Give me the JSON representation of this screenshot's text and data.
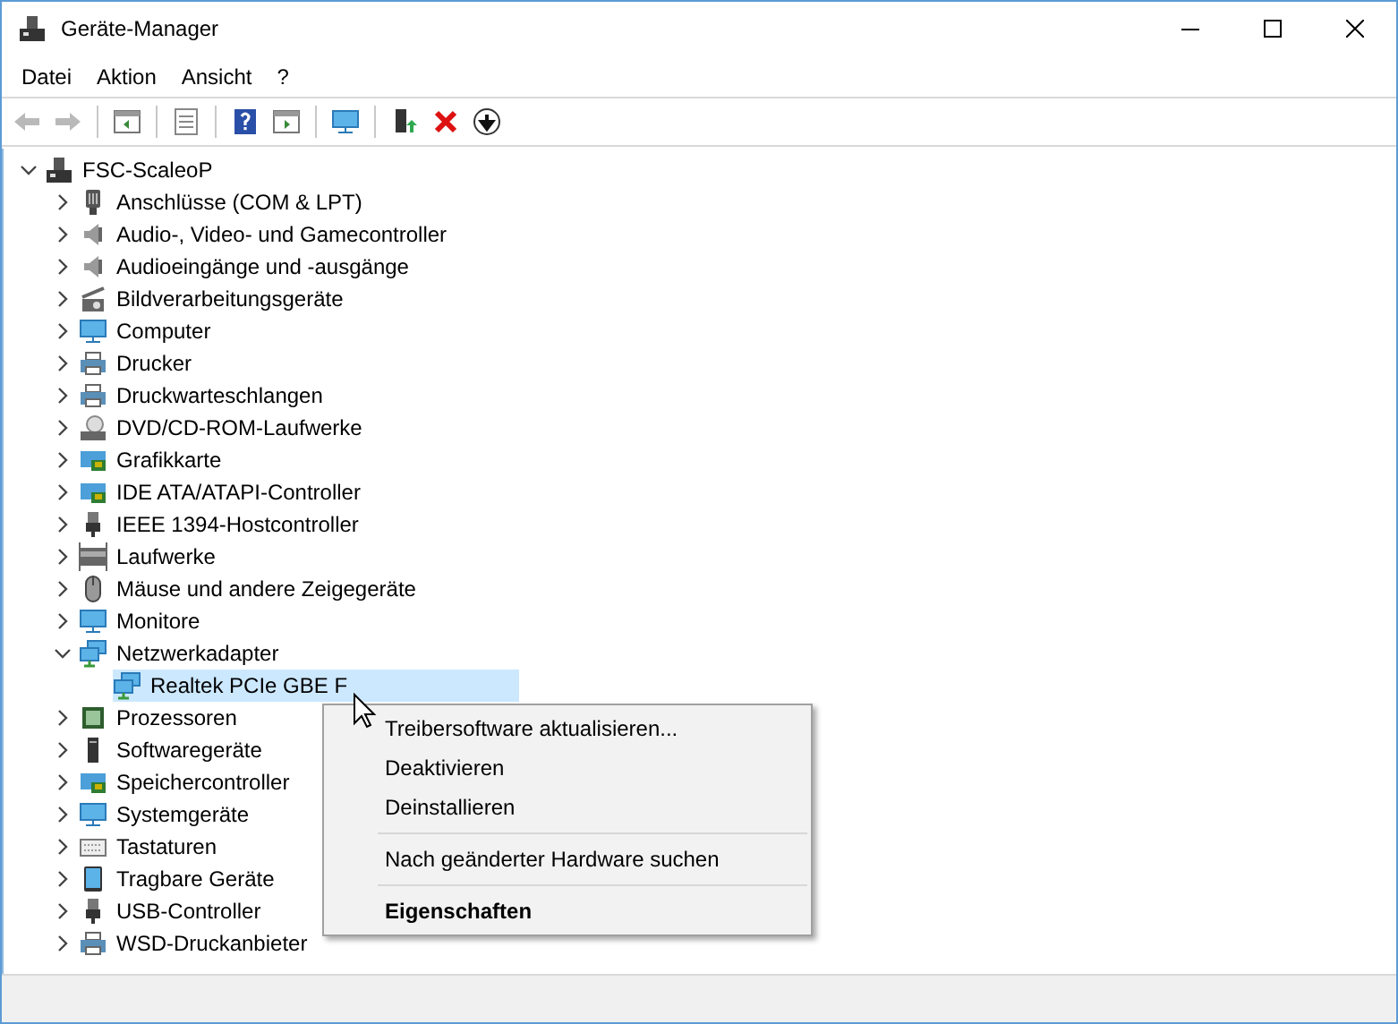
{
  "window": {
    "title": "Geräte-Manager"
  },
  "menu_bar": [
    "Datei",
    "Aktion",
    "Ansicht",
    "?"
  ],
  "toolbar": [
    {
      "kind": "back",
      "disabled": true
    },
    {
      "kind": "forward",
      "disabled": true
    },
    {
      "kind": "sep"
    },
    {
      "kind": "panel"
    },
    {
      "kind": "sep"
    },
    {
      "kind": "sheet"
    },
    {
      "kind": "sep"
    },
    {
      "kind": "help"
    },
    {
      "kind": "panel2"
    },
    {
      "kind": "sep"
    },
    {
      "kind": "monitor"
    },
    {
      "kind": "sep"
    },
    {
      "kind": "update"
    },
    {
      "kind": "remove"
    },
    {
      "kind": "down"
    }
  ],
  "tree": [
    {
      "label": "FSC-ScaleoP",
      "kind": "pc",
      "expanded": true,
      "selected": false,
      "children": [
        {
          "label": "Anschlüsse (COM & LPT)",
          "kind": "port",
          "expanded": false,
          "selected": false
        },
        {
          "label": "Audio-, Video- und Gamecontroller",
          "kind": "speaker",
          "expanded": false,
          "selected": false
        },
        {
          "label": "Audioeingänge und -ausgänge",
          "kind": "speaker",
          "expanded": false,
          "selected": false
        },
        {
          "label": "Bildverarbeitungsgeräte",
          "kind": "camera",
          "expanded": false,
          "selected": false
        },
        {
          "label": "Computer",
          "kind": "monitor",
          "expanded": false,
          "selected": false
        },
        {
          "label": "Drucker",
          "kind": "printer",
          "expanded": false,
          "selected": false
        },
        {
          "label": "Druckwarteschlangen",
          "kind": "printer",
          "expanded": false,
          "selected": false
        },
        {
          "label": "DVD/CD-ROM-Laufwerke",
          "kind": "disc",
          "expanded": false,
          "selected": false
        },
        {
          "label": "Grafikkarte",
          "kind": "card",
          "expanded": false,
          "selected": false
        },
        {
          "label": "IDE ATA/ATAPI-Controller",
          "kind": "card",
          "expanded": false,
          "selected": false
        },
        {
          "label": "IEEE 1394-Hostcontroller",
          "kind": "plug",
          "expanded": false,
          "selected": false
        },
        {
          "label": "Laufwerke",
          "kind": "drive",
          "expanded": false,
          "selected": false
        },
        {
          "label": "Mäuse und andere Zeigegeräte",
          "kind": "mouse",
          "expanded": false,
          "selected": false
        },
        {
          "label": "Monitore",
          "kind": "monitor",
          "expanded": false,
          "selected": false
        },
        {
          "label": "Netzwerkadapter",
          "kind": "network",
          "expanded": true,
          "selected": false,
          "children": [
            {
              "label": "Realtek PCIe GBE F",
              "kind": "network",
              "selected": true
            }
          ]
        },
        {
          "label": "Prozessoren",
          "kind": "chip",
          "expanded": false,
          "selected": false
        },
        {
          "label": "Softwaregeräte",
          "kind": "tower",
          "expanded": false,
          "selected": false
        },
        {
          "label": "Speichercontroller",
          "kind": "card",
          "expanded": false,
          "selected": false
        },
        {
          "label": "Systemgeräte",
          "kind": "monitor",
          "expanded": false,
          "selected": false
        },
        {
          "label": "Tastaturen",
          "kind": "keyboard",
          "expanded": false,
          "selected": false
        },
        {
          "label": "Tragbare Geräte",
          "kind": "tablet",
          "expanded": false,
          "selected": false
        },
        {
          "label": "USB-Controller",
          "kind": "plug",
          "expanded": false,
          "selected": false
        },
        {
          "label": "WSD-Druckanbieter",
          "kind": "printer",
          "expanded": false,
          "selected": false
        }
      ]
    }
  ],
  "context_menu": [
    {
      "kind": "item",
      "label": "Treibersoftware aktualisieren...",
      "default": false
    },
    {
      "kind": "item",
      "label": "Deaktivieren",
      "default": false
    },
    {
      "kind": "item",
      "label": "Deinstallieren",
      "default": false
    },
    {
      "kind": "separator"
    },
    {
      "kind": "item",
      "label": "Nach geänderter Hardware suchen",
      "default": false
    },
    {
      "kind": "separator"
    },
    {
      "kind": "item",
      "label": "Eigenschaften",
      "default": true
    }
  ]
}
